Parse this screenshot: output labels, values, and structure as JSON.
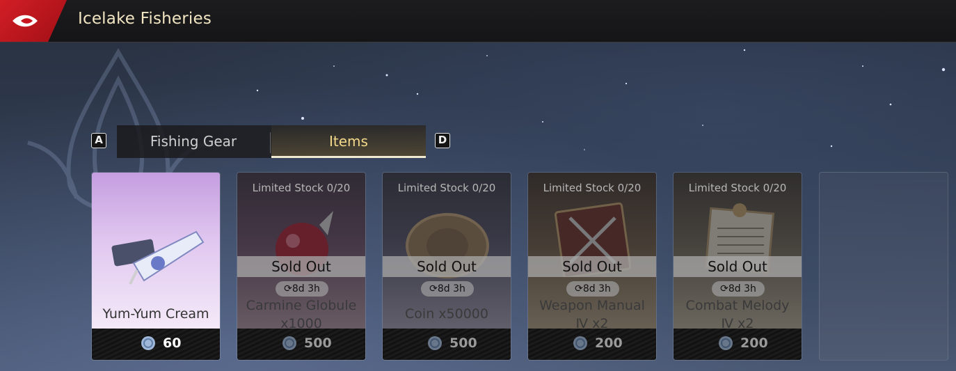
{
  "header": {
    "title": "Icelake Fisheries",
    "back_icon": "back-arrow-icon",
    "accent": "#d21e25"
  },
  "tabs": {
    "prev_key": "A",
    "next_key": "D",
    "items": [
      {
        "label": "Fishing Gear",
        "active": false
      },
      {
        "label": "Items",
        "active": true
      }
    ]
  },
  "shop_items": [
    {
      "name": "Yum-Yum Cream",
      "price": "60",
      "sold_out": false,
      "icon": "cream-tube-icon"
    },
    {
      "stock": "Limited Stock 0/20",
      "status": "Sold Out",
      "restock": "8d 3h",
      "name_line1": "Carmine Globule",
      "name_line2": "x1000",
      "price": "500",
      "icon": "carmine-globule-icon"
    },
    {
      "stock": "Limited Stock 0/20",
      "status": "Sold Out",
      "restock": "8d 3h",
      "name": "Coin x50000",
      "price": "500",
      "icon": "coin-icon"
    },
    {
      "stock": "Limited Stock 0/20",
      "status": "Sold Out",
      "restock": "8d 3h",
      "name_line1": "Weapon Manual",
      "name_line2": "Ⅳ x2",
      "price": "200",
      "icon": "weapon-manual-icon"
    },
    {
      "stock": "Limited Stock 0/20",
      "status": "Sold Out",
      "restock": "8d 3h",
      "name_line1": "Combat Melody",
      "name_line2": "Ⅳ x2",
      "price": "200",
      "icon": "combat-melody-icon"
    }
  ],
  "currency_icon": "shell-coin-icon"
}
